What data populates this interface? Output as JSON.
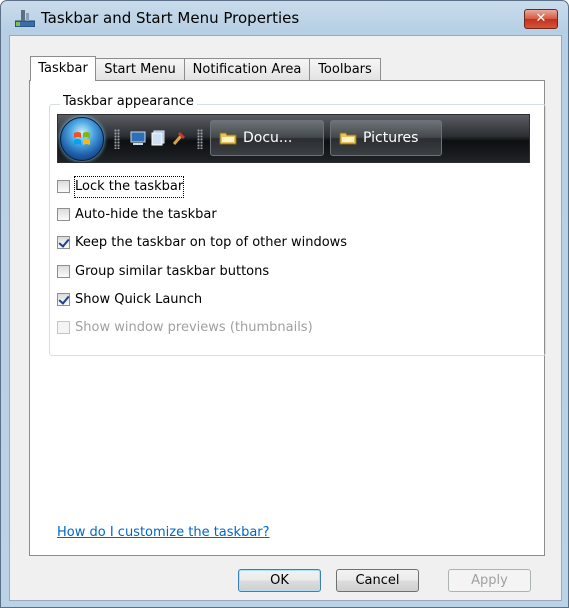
{
  "window": {
    "title": "Taskbar and Start Menu Properties",
    "close_glyph": "✕"
  },
  "tabs": [
    {
      "label": "Taskbar"
    },
    {
      "label": "Start Menu"
    },
    {
      "label": "Notification Area"
    },
    {
      "label": "Toolbars"
    }
  ],
  "appearance": {
    "group_label": "Taskbar appearance",
    "preview": {
      "buttons": [
        {
          "label": "Docu..."
        },
        {
          "label": "Pictures"
        }
      ]
    },
    "options": [
      {
        "label": "Lock the taskbar",
        "checked": false,
        "enabled": true
      },
      {
        "label": "Auto-hide the taskbar",
        "checked": false,
        "enabled": true
      },
      {
        "label": "Keep the taskbar on top of other windows",
        "checked": true,
        "enabled": true
      },
      {
        "label": "Group similar taskbar buttons",
        "checked": false,
        "enabled": true
      },
      {
        "label": "Show Quick Launch",
        "checked": true,
        "enabled": true
      },
      {
        "label": "Show window previews (thumbnails)",
        "checked": false,
        "enabled": false
      }
    ]
  },
  "help_link": "How do I customize the taskbar?",
  "buttons": {
    "ok": "OK",
    "cancel": "Cancel",
    "apply": "Apply"
  },
  "colors": {
    "link": "#0066cc",
    "close_button": "#c2321b",
    "check": "#1f3e8f"
  }
}
